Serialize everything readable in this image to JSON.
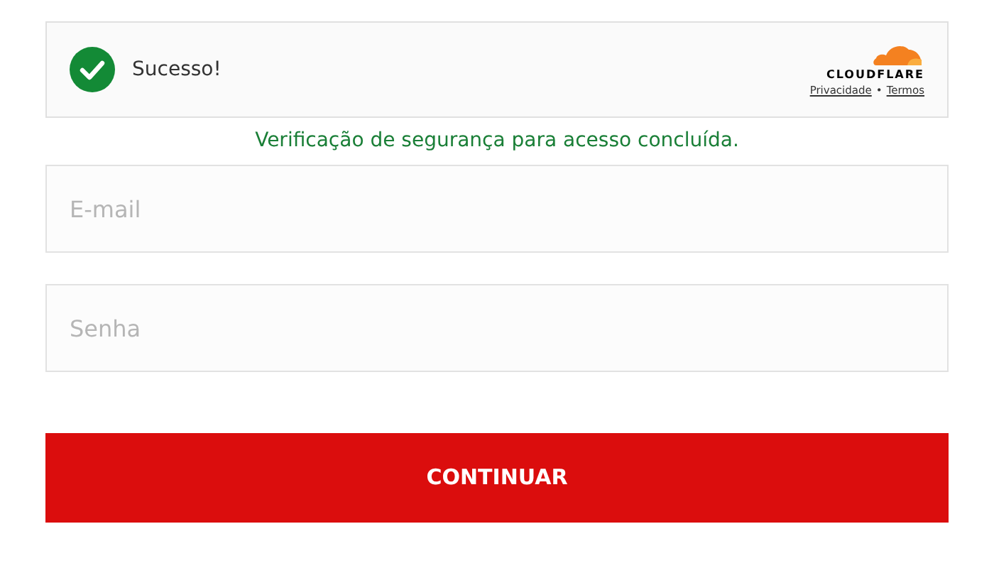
{
  "captcha": {
    "status": "Sucesso!",
    "success": true,
    "brand": "CLOUDFLARE",
    "links": [
      "Privacidade",
      "Termos"
    ],
    "separator": "•"
  },
  "message": "Verificação de segurança para acesso concluída.",
  "fields": [
    {
      "placeholder": "E-mail"
    },
    {
      "placeholder": "Senha"
    }
  ],
  "submit": "CONTINUAR"
}
